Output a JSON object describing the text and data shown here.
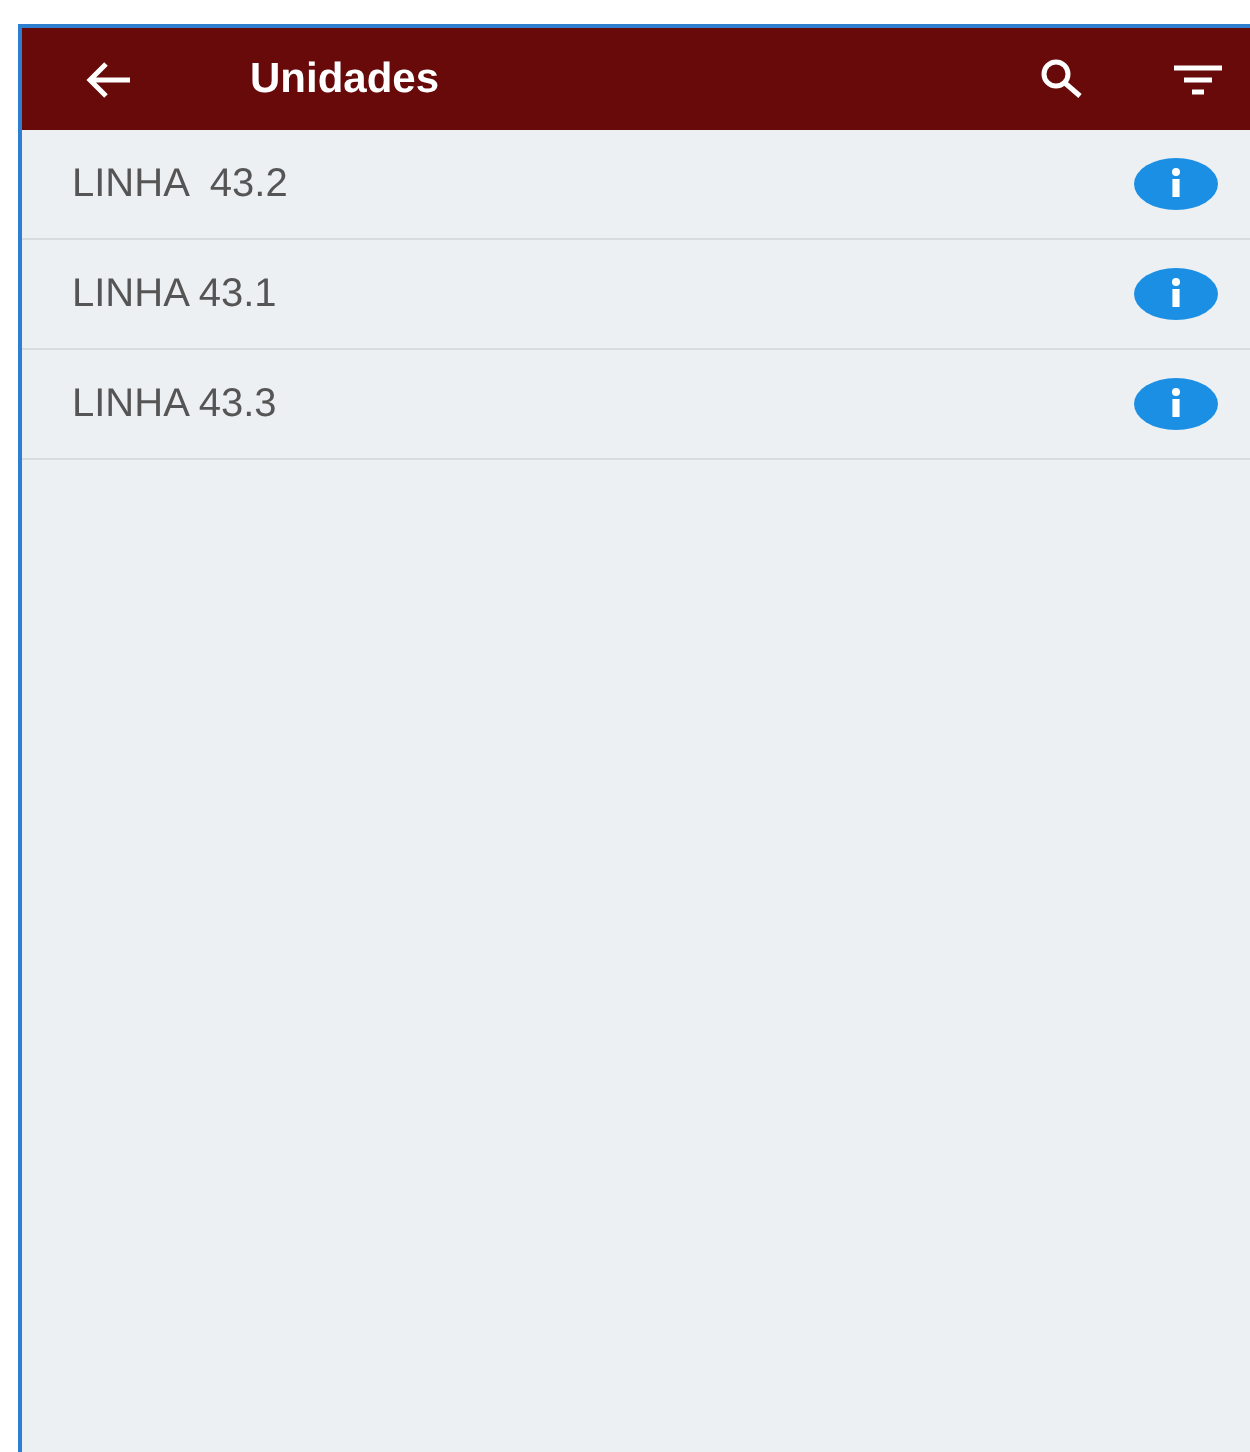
{
  "app_bar": {
    "title": "Unidades"
  },
  "units": [
    {
      "name": "LINHA  43.2"
    },
    {
      "name": "LINHA 43.1"
    },
    {
      "name": "LINHA 43.3"
    }
  ]
}
